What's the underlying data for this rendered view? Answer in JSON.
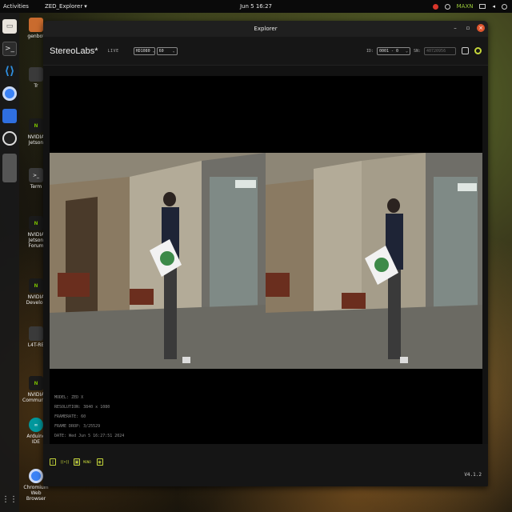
{
  "topbar": {
    "activities": "Activities",
    "app_menu": "ZED_Explorer",
    "clock": "Jun 5 16:27",
    "tray_label": "MAXN"
  },
  "dock": {
    "items": [
      "files-icon",
      "terminal-icon",
      "vscode-icon",
      "chromium-icon",
      "app-icon",
      "obs-icon",
      "window-icon"
    ]
  },
  "desktop_icons": [
    {
      "label": "genbot"
    },
    {
      "label": "Tr"
    },
    {
      "label": "NVIDIA Jetson"
    },
    {
      "label": "Term"
    },
    {
      "label": "NVIDIA Jetson Forum"
    },
    {
      "label": "NVIDIA Develop"
    },
    {
      "label": "L4T-RE"
    },
    {
      "label": "NVIDIA Community"
    },
    {
      "label": "Arduino IDE"
    },
    {
      "label": "Chromium Web Browser"
    }
  ],
  "window": {
    "title": "Explorer",
    "brand": "StereoLabs*",
    "live": "LIVE",
    "resolution": "HD1080",
    "fps": "60",
    "id_label": "ID:",
    "id_value": "0001 - 0",
    "sn_label": "SN:",
    "sn_value": "40720956"
  },
  "camera_info": {
    "model": "MODEL: ZED X",
    "resolution": "RESOLUTION: 3840 x 1080",
    "framerate": "FRAMERATE: 60",
    "frame_drop": "FRAME DROP: 3/25529",
    "date": "DATE: Wed Jun 5 16:27:51 2024"
  },
  "bottombar": {
    "mode_label": "MONO",
    "version": "V4.1.2"
  },
  "colors": {
    "accent": "#c5d63a",
    "close": "#e0562e",
    "window_bg": "#121212"
  }
}
